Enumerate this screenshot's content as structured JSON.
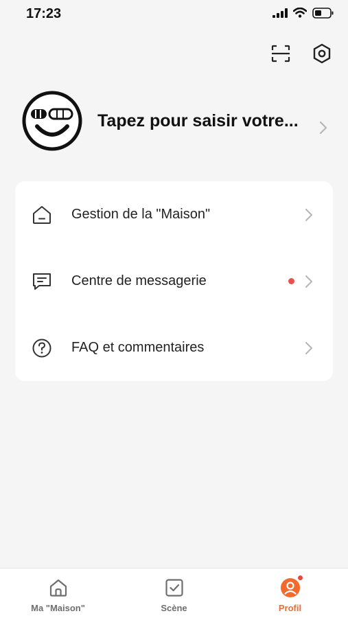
{
  "status_bar": {
    "time": "17:23",
    "icons": [
      "signal-icon",
      "wifi-icon",
      "battery-icon"
    ]
  },
  "top_actions": {
    "icons": [
      "scan-icon",
      "settings-icon"
    ]
  },
  "profile": {
    "name": "Tapez pour saisir votre...",
    "avatar_icon": "smiley-avatar-icon"
  },
  "menu": {
    "items": [
      {
        "label": "Gestion de la \"Maison\"",
        "icon": "home-icon",
        "badge": false
      },
      {
        "label": "Centre de messagerie",
        "icon": "message-icon",
        "badge": true
      },
      {
        "label": "FAQ et commentaires",
        "icon": "help-icon",
        "badge": false
      }
    ]
  },
  "tab_bar": {
    "tabs": [
      {
        "label": "Ma \"Maison\"",
        "icon": "home-icon",
        "active": false
      },
      {
        "label": "Scène",
        "icon": "scene-checkbox-icon",
        "active": false
      },
      {
        "label": "Profil",
        "icon": "profile-icon",
        "active": true,
        "badge": true
      }
    ]
  },
  "colors": {
    "accent": "#f26b2d",
    "badge": "#e5534b",
    "background": "#f5f5f5",
    "card": "#ffffff"
  }
}
